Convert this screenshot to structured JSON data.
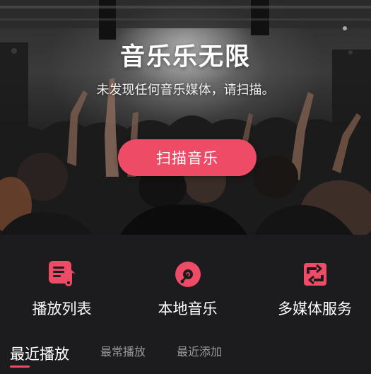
{
  "hero": {
    "title": "音乐乐无限",
    "subtitle": "未发现任何音乐媒体，请扫描。",
    "scan_button_label": "扫描音乐"
  },
  "features": [
    {
      "label": "播放列表",
      "icon": "playlist-icon"
    },
    {
      "label": "本地音乐",
      "icon": "vinyl-disc-icon"
    },
    {
      "label": "多媒体服务",
      "icon": "sync-icon"
    }
  ],
  "tabs": [
    {
      "label": "最近播放",
      "active": true
    },
    {
      "label": "最常播放",
      "active": false
    },
    {
      "label": "最近添加",
      "active": false
    }
  ],
  "colors": {
    "accent": "#ee4b67",
    "background": "#1c1c1e",
    "inactive_tab": "#9a9a9a"
  }
}
